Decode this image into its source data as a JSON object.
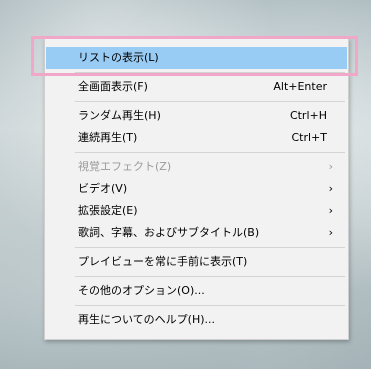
{
  "menu": {
    "items": [
      {
        "label": "リストの表示(L)",
        "shortcut": "",
        "submenu": false,
        "enabled": true,
        "selected": true
      },
      {
        "label": "全画面表示(F)",
        "shortcut": "Alt+Enter",
        "submenu": false,
        "enabled": true,
        "selected": false
      },
      {
        "label": "ランダム再生(H)",
        "shortcut": "Ctrl+H",
        "submenu": false,
        "enabled": true,
        "selected": false
      },
      {
        "label": "連続再生(T)",
        "shortcut": "Ctrl+T",
        "submenu": false,
        "enabled": true,
        "selected": false
      },
      {
        "label": "視覚エフェクト(Z)",
        "shortcut": "",
        "submenu": true,
        "enabled": false,
        "selected": false
      },
      {
        "label": "ビデオ(V)",
        "shortcut": "",
        "submenu": true,
        "enabled": true,
        "selected": false
      },
      {
        "label": "拡張設定(E)",
        "shortcut": "",
        "submenu": true,
        "enabled": true,
        "selected": false
      },
      {
        "label": "歌詞、字幕、およびサブタイトル(B)",
        "shortcut": "",
        "submenu": true,
        "enabled": true,
        "selected": false
      },
      {
        "label": "プレイビューを常に手前に表示(T)",
        "shortcut": "",
        "submenu": false,
        "enabled": true,
        "selected": false
      },
      {
        "label": "その他のオプション(O)...",
        "shortcut": "",
        "submenu": false,
        "enabled": true,
        "selected": false
      },
      {
        "label": "再生についてのヘルプ(H)...",
        "shortcut": "",
        "submenu": false,
        "enabled": true,
        "selected": false
      }
    ],
    "submenu_arrow": "›"
  },
  "colors": {
    "selected_bg": "#99ccf5",
    "highlight_border": "#f1a8c8",
    "menu_bg": "#f2f2f2",
    "disabled_text": "#9a9a9a"
  }
}
